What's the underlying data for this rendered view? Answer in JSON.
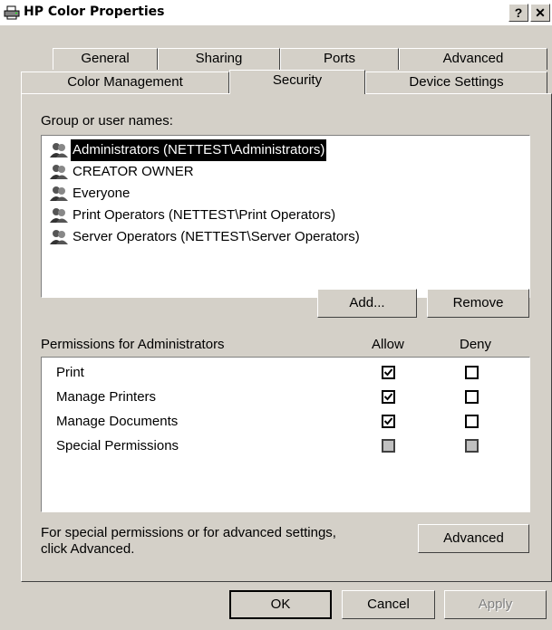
{
  "window": {
    "title": "HP Color Properties",
    "help_button": "?",
    "close_button": "✕"
  },
  "tabs": {
    "row1": [
      "General",
      "Sharing",
      "Ports",
      "Advanced"
    ],
    "row2": [
      "Color Management",
      "Security",
      "Device Settings"
    ],
    "active": "Security"
  },
  "groups": {
    "label": "Group or user names:",
    "items": [
      {
        "name": "Administrators (NETTEST\\Administrators)",
        "selected": true
      },
      {
        "name": "CREATOR OWNER",
        "selected": false
      },
      {
        "name": "Everyone",
        "selected": false
      },
      {
        "name": "Print Operators (NETTEST\\Print Operators)",
        "selected": false
      },
      {
        "name": "Server Operators (NETTEST\\Server Operators)",
        "selected": false
      }
    ],
    "add_label": "Add...",
    "remove_label": "Remove"
  },
  "permissions": {
    "label": "Permissions for Administrators",
    "allow_header": "Allow",
    "deny_header": "Deny",
    "rows": [
      {
        "name": "Print",
        "allow": "checked",
        "deny": "unchecked"
      },
      {
        "name": "Manage Printers",
        "allow": "checked",
        "deny": "unchecked"
      },
      {
        "name": "Manage Documents",
        "allow": "checked",
        "deny": "unchecked"
      },
      {
        "name": "Special Permissions",
        "allow": "disabled",
        "deny": "disabled"
      }
    ]
  },
  "advanced": {
    "text_line1": "For special permissions or for advanced settings,",
    "text_line2": "click Advanced.",
    "button_label": "Advanced"
  },
  "footer": {
    "ok_label": "OK",
    "cancel_label": "Cancel",
    "apply_label": "Apply"
  }
}
